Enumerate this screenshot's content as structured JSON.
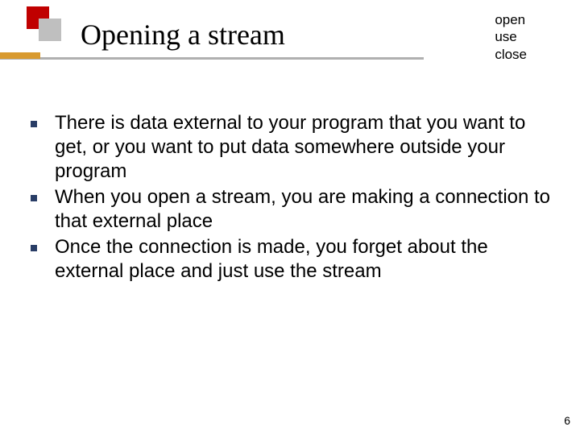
{
  "header": {
    "title": "Opening a stream",
    "annotation": {
      "line1": "open",
      "line2": "use",
      "line3": "close"
    }
  },
  "bullets": {
    "items": [
      {
        "text": "There is data external to your program that you want to get, or you want to put data somewhere outside your program"
      },
      {
        "text": "When you open a stream, you are making a connection to that external place"
      },
      {
        "text": "Once the connection is made, you forget about the external place and just use the stream"
      }
    ]
  },
  "page": {
    "number": "6"
  }
}
